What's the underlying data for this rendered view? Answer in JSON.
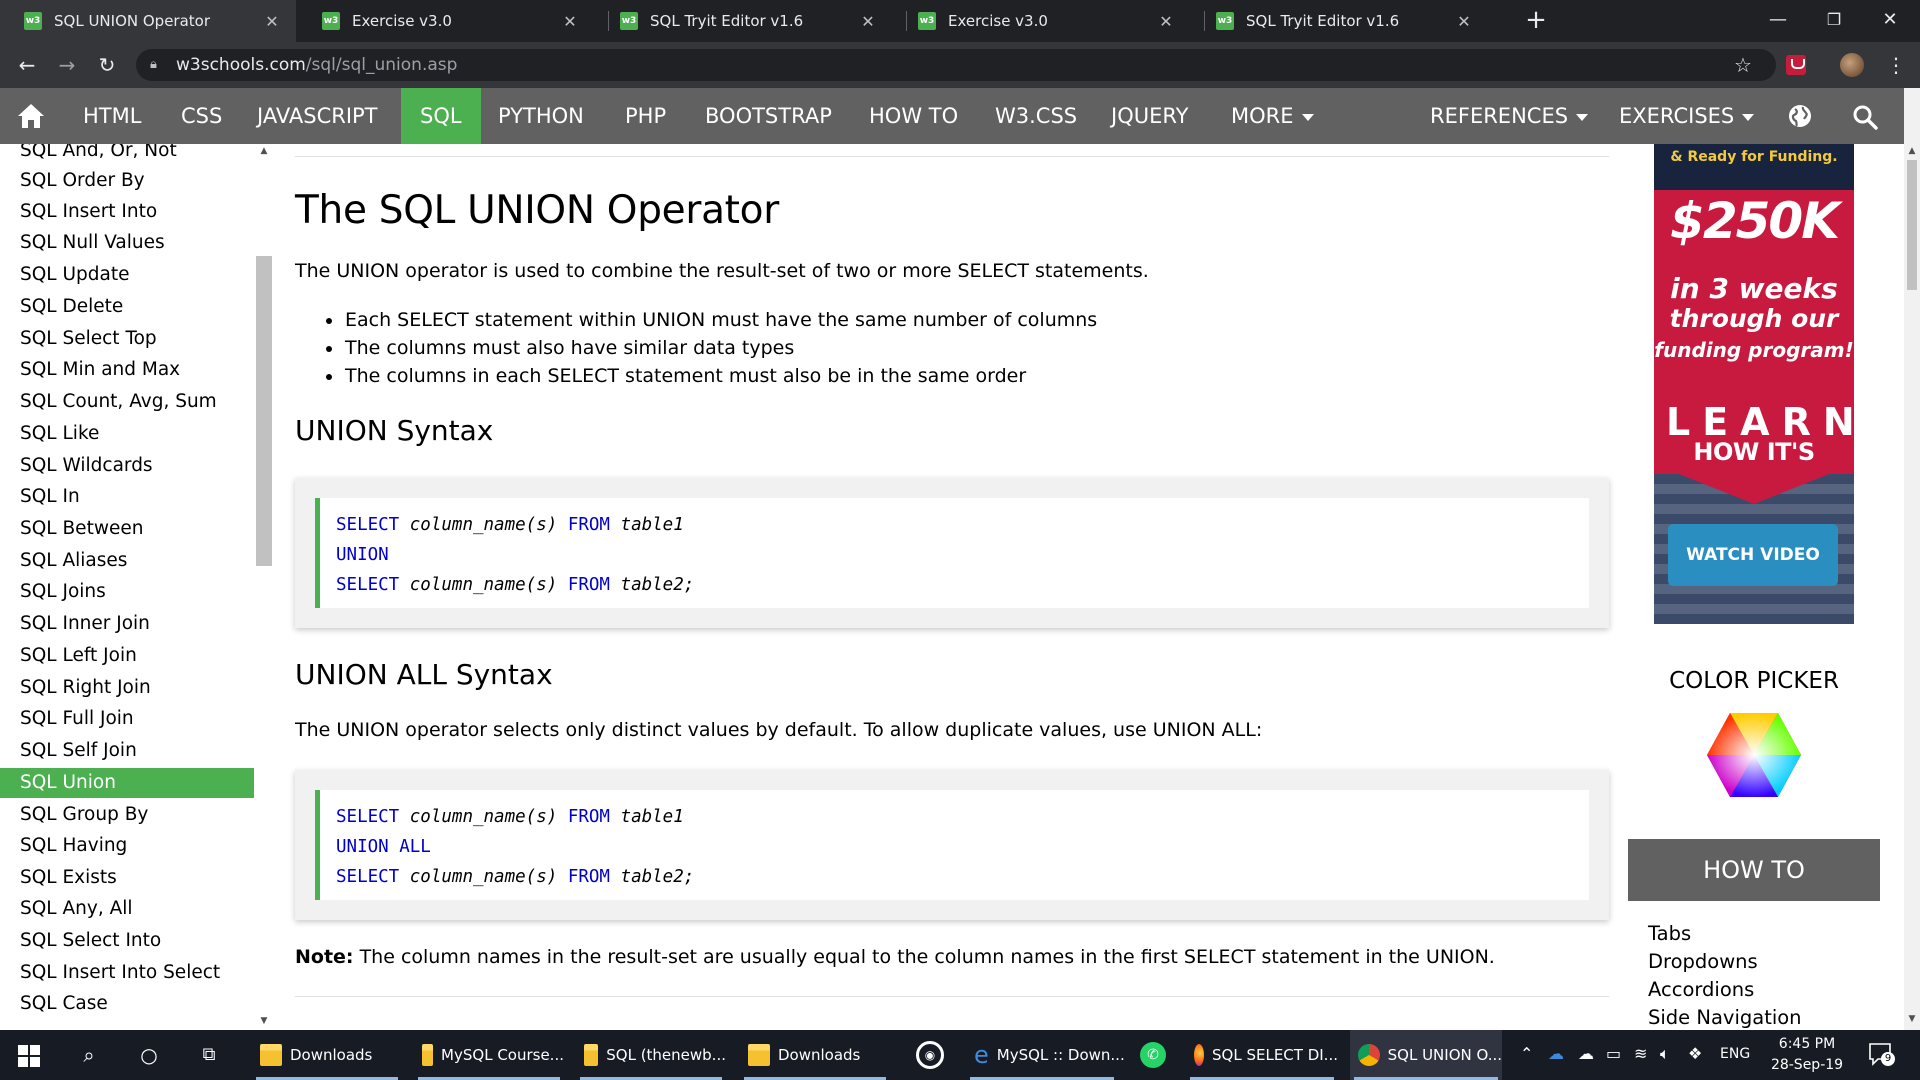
{
  "browser": {
    "tabs": [
      {
        "title": "SQL UNION Operator",
        "favicon": "w3"
      },
      {
        "title": "Exercise v3.0",
        "favicon": "w3"
      },
      {
        "title": "SQL Tryit Editor v1.6",
        "favicon": "w3"
      },
      {
        "title": "Exercise v3.0",
        "favicon": "w3"
      },
      {
        "title": "SQL Tryit Editor v1.6",
        "favicon": "w3"
      }
    ],
    "active_tab_index": 0,
    "url_host": "w3schools.com",
    "url_path": "/sql/sql_union.asp",
    "icons": [
      "back-icon",
      "forward-icon",
      "reload-icon",
      "lock-icon",
      "star-icon",
      "extension-icon",
      "menu-icon"
    ]
  },
  "topnav": {
    "items": [
      "HTML",
      "CSS",
      "JAVASCRIPT",
      "SQL",
      "PYTHON",
      "PHP",
      "BOOTSTRAP",
      "HOW TO",
      "W3.CSS",
      "JQUERY"
    ],
    "active": "SQL",
    "more": "MORE",
    "references": "REFERENCES",
    "exercises": "EXERCISES",
    "colors": {
      "bar": "#616161",
      "active": "#4caf50"
    }
  },
  "sidebar": {
    "items": [
      "SQL And, Or, Not",
      "SQL Order By",
      "SQL Insert Into",
      "SQL Null Values",
      "SQL Update",
      "SQL Delete",
      "SQL Select Top",
      "SQL Min and Max",
      "SQL Count, Avg, Sum",
      "SQL Like",
      "SQL Wildcards",
      "SQL In",
      "SQL Between",
      "SQL Aliases",
      "SQL Joins",
      "SQL Inner Join",
      "SQL Left Join",
      "SQL Right Join",
      "SQL Full Join",
      "SQL Self Join",
      "SQL Union",
      "SQL Group By",
      "SQL Having",
      "SQL Exists",
      "SQL Any, All",
      "SQL Select Into",
      "SQL Insert Into Select",
      "SQL Case"
    ],
    "active": "SQL Union"
  },
  "main": {
    "title": "The SQL UNION Operator",
    "intro": "The UNION operator is used to combine the result-set of two or more SELECT statements.",
    "bullets": [
      "Each SELECT statement within UNION must have the same number of columns",
      "The columns must also have similar data types",
      "The columns in each SELECT statement must also be in the same order"
    ],
    "syntax_heading": "UNION Syntax",
    "syntax_code": {
      "line1": {
        "kw1": "SELECT",
        "arg1": "column_name(s)",
        "kw2": "FROM",
        "arg2": "table1"
      },
      "line2": {
        "kw1": "UNION"
      },
      "line3": {
        "kw1": "SELECT",
        "arg1": "column_name(s)",
        "kw2": "FROM",
        "arg2": "table2;"
      }
    },
    "syntax_all_heading": "UNION ALL Syntax",
    "syntax_all_intro": "The UNION operator selects only distinct values by default. To allow duplicate values, use UNION ALL:",
    "syntax_all_code": {
      "line1": {
        "kw1": "SELECT",
        "arg1": "column_name(s)",
        "kw2": "FROM",
        "arg2": "table1"
      },
      "line2": {
        "kw1": "UNION ALL"
      },
      "line3": {
        "kw1": "SELECT",
        "arg1": "column_name(s)",
        "kw2": "FROM",
        "arg2": "table2;"
      }
    },
    "note_label": "Note:",
    "note_text": "The column names in the result-set are usually equal to the column names in the first SELECT statement in the UNION."
  },
  "right": {
    "ad": {
      "top_text": "& Ready for Funding.",
      "amount": "$250K",
      "line1": "in 3 weeks",
      "line2": "through our",
      "line3": "funding program!",
      "learn": "LEARN",
      "how": "HOW IT'S DONE",
      "button": "WATCH VIDEO"
    },
    "color_picker": "COLOR PICKER",
    "howto_title": "HOW TO",
    "howto_links": [
      "Tabs",
      "Dropdowns",
      "Accordions",
      "Side Navigation"
    ]
  },
  "taskbar": {
    "apps": [
      {
        "label": "Downloads",
        "icon": "folder-icon"
      },
      {
        "label": "MySQL Course...",
        "icon": "folder-icon"
      },
      {
        "label": "SQL (thenewb...",
        "icon": "folder-icon"
      },
      {
        "label": "Downloads",
        "icon": "folder-icon"
      },
      {
        "label": "MySQL :: Down...",
        "icon": "edge-icon"
      },
      {
        "label": "SQL SELECT DI...",
        "icon": "firefox-icon"
      },
      {
        "label": "SQL UNION O...",
        "icon": "chrome-icon"
      }
    ],
    "language": "ENG",
    "time": "6:45 PM",
    "date": "28-Sep-19",
    "notifications": "9"
  }
}
